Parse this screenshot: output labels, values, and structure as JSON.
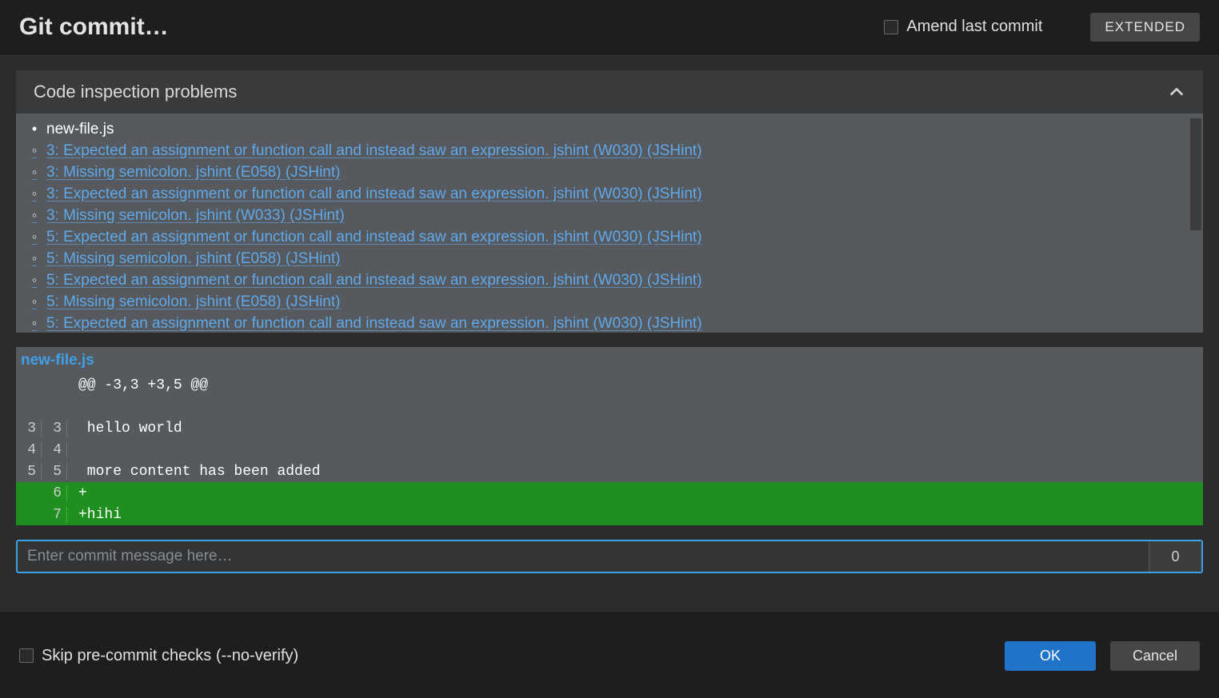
{
  "header": {
    "title": "Git commit…",
    "amend_label": "Amend last commit",
    "extended_label": "EXTENDED"
  },
  "inspection": {
    "title": "Code inspection problems",
    "file": "new-file.js",
    "issues": [
      "3: Expected an assignment or function call and instead saw an expression. jshint (W030) (JSHint)",
      "3: Missing semicolon. jshint (E058) (JSHint)",
      "3: Expected an assignment or function call and instead saw an expression. jshint (W030) (JSHint)",
      "3: Missing semicolon. jshint (W033) (JSHint)",
      "5: Expected an assignment or function call and instead saw an expression. jshint (W030) (JSHint)",
      "5: Missing semicolon. jshint (E058) (JSHint)",
      "5: Expected an assignment or function call and instead saw an expression. jshint (W030) (JSHint)",
      "5: Missing semicolon. jshint (E058) (JSHint)",
      "5: Expected an assignment or function call and instead saw an expression. jshint (W030) (JSHint)"
    ]
  },
  "diff": {
    "file": "new-file.js",
    "hunk": "@@ -3,3 +3,5 @@",
    "lines": [
      {
        "old": "3",
        "new": "3",
        "type": "ctx",
        "text": " hello world"
      },
      {
        "old": "4",
        "new": "4",
        "type": "ctx",
        "text": " "
      },
      {
        "old": "5",
        "new": "5",
        "type": "ctx",
        "text": " more content has been added"
      },
      {
        "old": "",
        "new": "6",
        "type": "added",
        "text": "+"
      },
      {
        "old": "",
        "new": "7",
        "type": "added",
        "text": "+hihi"
      }
    ]
  },
  "commit": {
    "placeholder": "Enter commit message here…",
    "counter": "0"
  },
  "footer": {
    "skip_label": "Skip pre-commit checks (--no-verify)",
    "ok_label": "OK",
    "cancel_label": "Cancel"
  }
}
